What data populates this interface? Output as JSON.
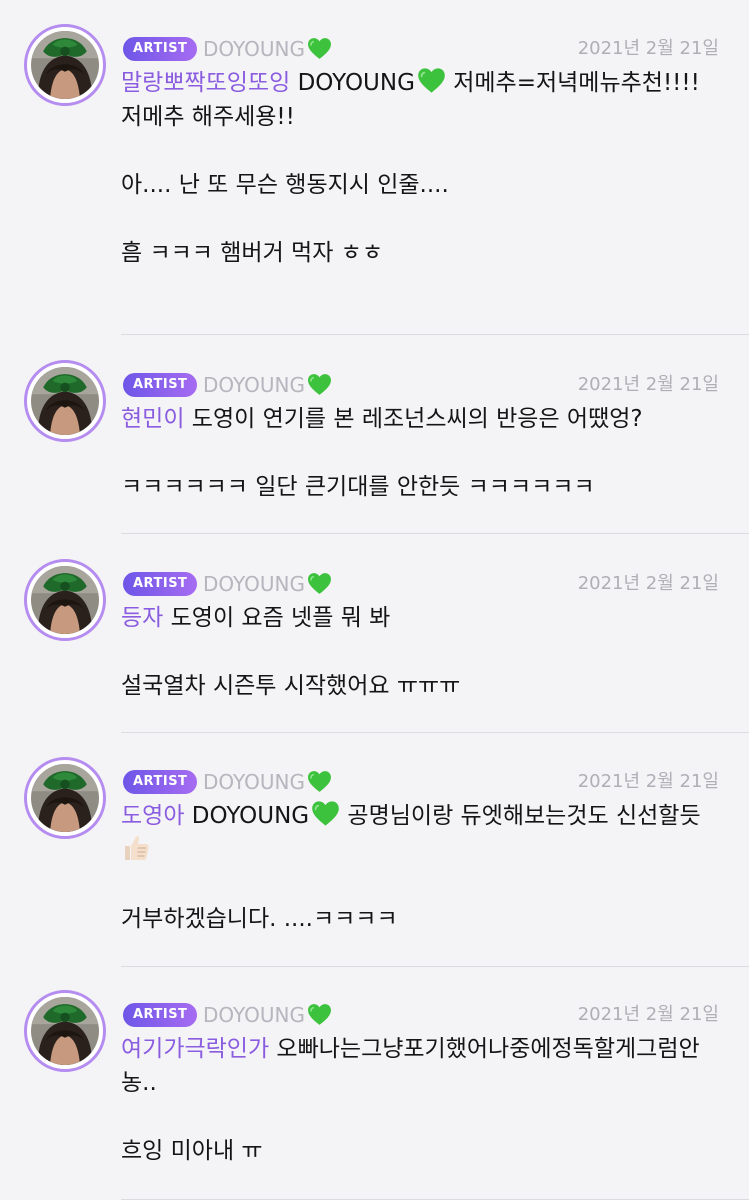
{
  "posts": [
    {
      "badge": "ARTIST",
      "artist_name": "DOYOUNG",
      "date": "2021년 2월 21일",
      "fan_name": "말랑뽀짝또잉또잉",
      "artist_inline": "DOYOUNG",
      "line1_rest": " 저메추=저녁메뉴추천!!!!",
      "line2": "저메추 해주세용!!",
      "line3": "아.... 난 또 무슨 행동지시 인줄....",
      "line4": "흠 ㅋㅋㅋ 햄버거 먹자 ㅎㅎ"
    },
    {
      "badge": "ARTIST",
      "artist_name": "DOYOUNG",
      "date": "2021년 2월 21일",
      "fan_name": "현민이",
      "line1_rest": " 도영이 연기를 본 레조넌스씨의 반응은 어땠엉?",
      "reply": "ㅋㅋㅋㅋㅋㅋ 일단 큰기대를 안한듯 ㅋㅋㅋㅋㅋㅋ"
    },
    {
      "badge": "ARTIST",
      "artist_name": "DOYOUNG",
      "date": "2021년 2월 21일",
      "fan_name": "등자",
      "line1_rest": " 도영이 요즘 넷플 뭐 봐",
      "reply": "설국열차 시즌투 시작했어요 ㅠㅠㅠ"
    },
    {
      "badge": "ARTIST",
      "artist_name": "DOYOUNG",
      "date": "2021년 2월 21일",
      "fan_name": "도영아",
      "artist_inline": "DOYOUNG",
      "line1_rest": "  공명님이랑 듀엣해보는것도 신선할듯",
      "reply": "거부하겠습니다.  ....ㅋㅋㅋㅋ"
    },
    {
      "badge": "ARTIST",
      "artist_name": "DOYOUNG",
      "date": "2021년 2월 21일",
      "fan_name": "여기가극락인가",
      "line1_rest": " 오빠나는그냥포기했어나중에정독할게그럼안농..",
      "reply": "흐잉 미아내 ㅠ"
    }
  ],
  "icons": {
    "heart": "green-heart-icon",
    "thumb": "thumbs-up-icon",
    "avatar": "profile-photo"
  },
  "colors": {
    "badge_start": "#6e56e8",
    "badge_end": "#a66cf1",
    "fan_name": "#8a5ce0",
    "heart": "#3cc23c",
    "muted": "#b7b5bd"
  }
}
